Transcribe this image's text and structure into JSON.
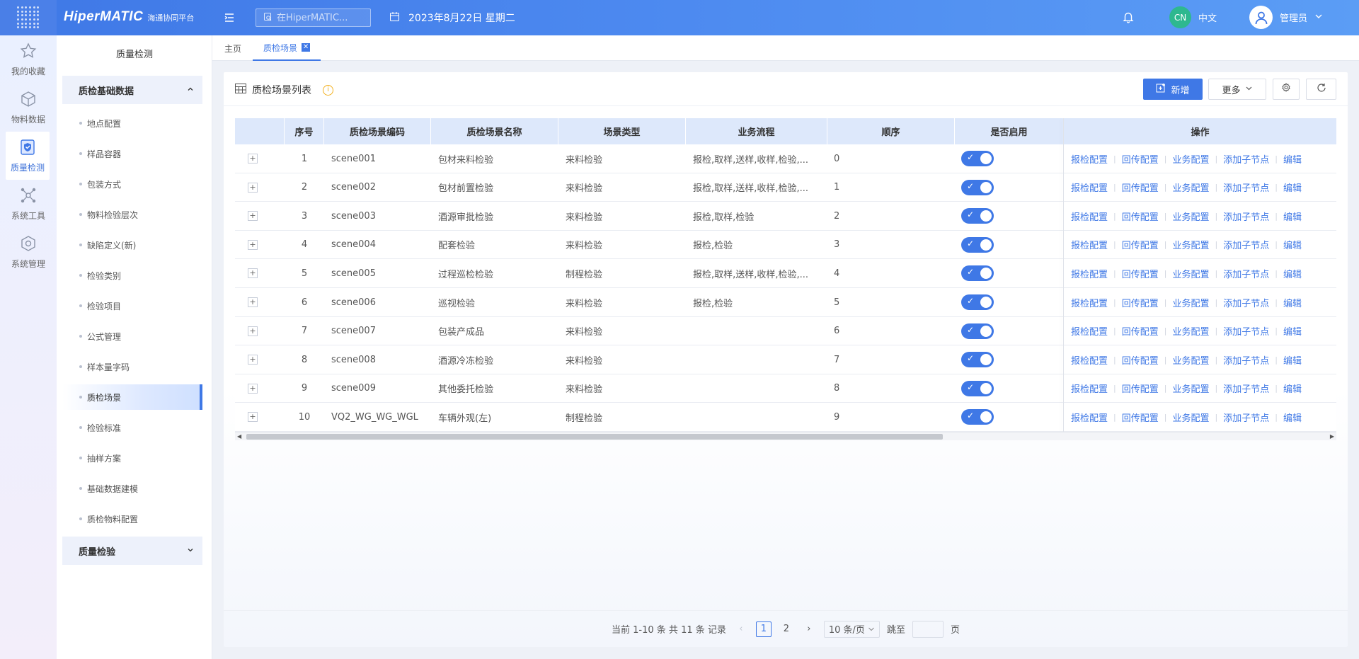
{
  "colors": {
    "primary": "#3f78e6",
    "header_bg": "#4d8af0",
    "switch_on": "#3f78e6",
    "info": "#f2b01e"
  },
  "header": {
    "brand": "HiperMATIC",
    "brand_sub": "海通协同平台",
    "search_placeholder": "在HiperMATIC...",
    "date": "2023年8月22日 星期二",
    "lang_code": "CN",
    "lang_label": "中文",
    "user_name": "管理员"
  },
  "rail": [
    {
      "label": "我的收藏",
      "icon": "star-icon"
    },
    {
      "label": "物料数据",
      "icon": "cube-icon"
    },
    {
      "label": "质量检测",
      "icon": "shield-check-icon"
    },
    {
      "label": "系统工具",
      "icon": "network-icon"
    },
    {
      "label": "系统管理",
      "icon": "hexagon-gear-icon"
    }
  ],
  "sidebar": {
    "title": "质量检测",
    "group1": "质检基础数据",
    "items": [
      "地点配置",
      "样品容器",
      "包装方式",
      "物料检验层次",
      "缺陷定义(新)",
      "检验类别",
      "检验项目",
      "公式管理",
      "样本量字码",
      "质检场景",
      "检验标准",
      "抽样方案",
      "基础数据建模",
      "质检物料配置"
    ],
    "group2": "质量检验"
  },
  "tabs": {
    "home": "主页",
    "current": "质检场景"
  },
  "panel": {
    "title": "质检场景列表",
    "add_label": "新增",
    "more_label": "更多"
  },
  "table": {
    "headers": [
      "序号",
      "质检场景编码",
      "质检场景名称",
      "场景类型",
      "业务流程",
      "顺序",
      "是否启用",
      "操作"
    ],
    "ops": [
      "报检配置",
      "回传配置",
      "业务配置",
      "添加子节点",
      "编辑"
    ],
    "rows": [
      {
        "no": "1",
        "code": "scene001",
        "name": "包材来料检验",
        "type": "来料检验",
        "flow": "报检,取样,送样,收样,检验,...",
        "order": "0"
      },
      {
        "no": "2",
        "code": "scene002",
        "name": "包材前置检验",
        "type": "来料检验",
        "flow": "报检,取样,送样,收样,检验,...",
        "order": "1"
      },
      {
        "no": "3",
        "code": "scene003",
        "name": "酒源审批检验",
        "type": "来料检验",
        "flow": "报检,取样,检验",
        "order": "2"
      },
      {
        "no": "4",
        "code": "scene004",
        "name": "配套检验",
        "type": "来料检验",
        "flow": "报检,检验",
        "order": "3"
      },
      {
        "no": "5",
        "code": "scene005",
        "name": "过程巡检检验",
        "type": "制程检验",
        "flow": "报检,取样,送样,收样,检验,...",
        "order": "4"
      },
      {
        "no": "6",
        "code": "scene006",
        "name": "巡视检验",
        "type": "来料检验",
        "flow": "报检,检验",
        "order": "5"
      },
      {
        "no": "7",
        "code": "scene007",
        "name": "包装产成品",
        "type": "来料检验",
        "flow": "",
        "order": "6"
      },
      {
        "no": "8",
        "code": "scene008",
        "name": "酒源冷冻检验",
        "type": "来料检验",
        "flow": "",
        "order": "7"
      },
      {
        "no": "9",
        "code": "scene009",
        "name": "其他委托检验",
        "type": "来料检验",
        "flow": "",
        "order": "8"
      },
      {
        "no": "10",
        "code": "VQ2_WG_WG_WGL",
        "name": "车辆外观(左)",
        "type": "制程检验",
        "flow": "",
        "order": "9"
      }
    ]
  },
  "pager": {
    "summary": "当前 1-10 条 共 11 条 记录",
    "page1": "1",
    "page2": "2",
    "size": "10 条/页",
    "jump_label": "跳至",
    "page_unit": "页"
  }
}
